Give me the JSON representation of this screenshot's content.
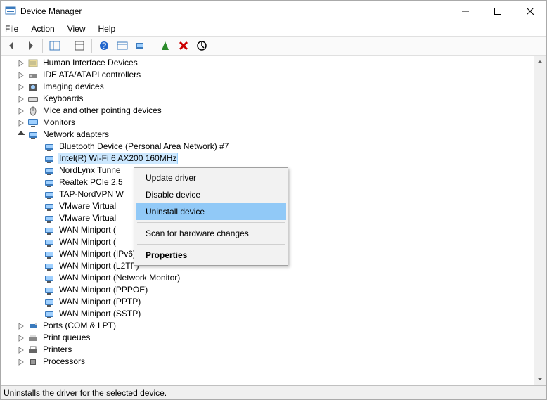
{
  "window": {
    "title": "Device Manager"
  },
  "menubar": [
    "File",
    "Action",
    "View",
    "Help"
  ],
  "statusbar": "Uninstalls the driver for the selected device.",
  "context_menu": {
    "items": [
      {
        "label": "Update driver",
        "sep_after": false,
        "highlight": false,
        "bold": false
      },
      {
        "label": "Disable device",
        "sep_after": false,
        "highlight": false,
        "bold": false
      },
      {
        "label": "Uninstall device",
        "sep_after": true,
        "highlight": true,
        "bold": false
      },
      {
        "label": "Scan for hardware changes",
        "sep_after": true,
        "highlight": false,
        "bold": false
      },
      {
        "label": "Properties",
        "sep_after": false,
        "highlight": false,
        "bold": true
      }
    ]
  },
  "tree": {
    "categories": [
      {
        "label": "Human Interface Devices",
        "icon": "hid",
        "expanded": false
      },
      {
        "label": "IDE ATA/ATAPI controllers",
        "icon": "ide",
        "expanded": false
      },
      {
        "label": "Imaging devices",
        "icon": "imaging",
        "expanded": false
      },
      {
        "label": "Keyboards",
        "icon": "keyboard",
        "expanded": false
      },
      {
        "label": "Mice and other pointing devices",
        "icon": "mouse",
        "expanded": false
      },
      {
        "label": "Monitors",
        "icon": "monitor",
        "expanded": false
      },
      {
        "label": "Network adapters",
        "icon": "net",
        "expanded": true,
        "children": [
          {
            "label": "Bluetooth Device (Personal Area Network) #7"
          },
          {
            "label": "Intel(R) Wi-Fi 6 AX200 160MHz",
            "selected": true
          },
          {
            "label": "NordLynx Tunne"
          },
          {
            "label": "Realtek PCIe 2.5"
          },
          {
            "label": "TAP-NordVPN W"
          },
          {
            "label": "VMware Virtual "
          },
          {
            "label": "VMware Virtual "
          },
          {
            "label": "WAN Miniport ("
          },
          {
            "label": "WAN Miniport ("
          },
          {
            "label": "WAN Miniport (IPv6)"
          },
          {
            "label": "WAN Miniport (L2TP)"
          },
          {
            "label": "WAN Miniport (Network Monitor)"
          },
          {
            "label": "WAN Miniport (PPPOE)"
          },
          {
            "label": "WAN Miniport (PPTP)"
          },
          {
            "label": "WAN Miniport (SSTP)"
          }
        ]
      },
      {
        "label": "Ports (COM & LPT)",
        "icon": "ports",
        "expanded": false
      },
      {
        "label": "Print queues",
        "icon": "printq",
        "expanded": false
      },
      {
        "label": "Printers",
        "icon": "printer",
        "expanded": false
      },
      {
        "label": "Processors",
        "icon": "cpu",
        "expanded": false
      }
    ]
  }
}
